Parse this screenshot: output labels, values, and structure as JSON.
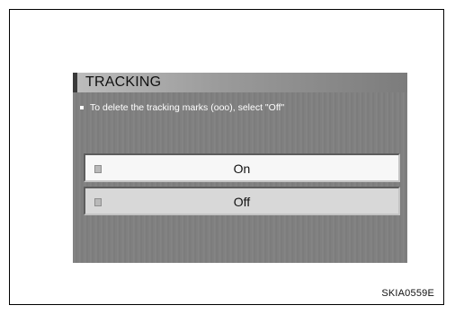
{
  "screen": {
    "title": "TRACKING",
    "info_text": "To delete the tracking marks (ooo), select \"Off\"",
    "options": [
      {
        "label": "On",
        "icon": "option-indicator-icon"
      },
      {
        "label": "Off",
        "icon": "option-indicator-icon",
        "selected": true
      }
    ]
  },
  "figure": {
    "caption": "SKIA0559E"
  }
}
